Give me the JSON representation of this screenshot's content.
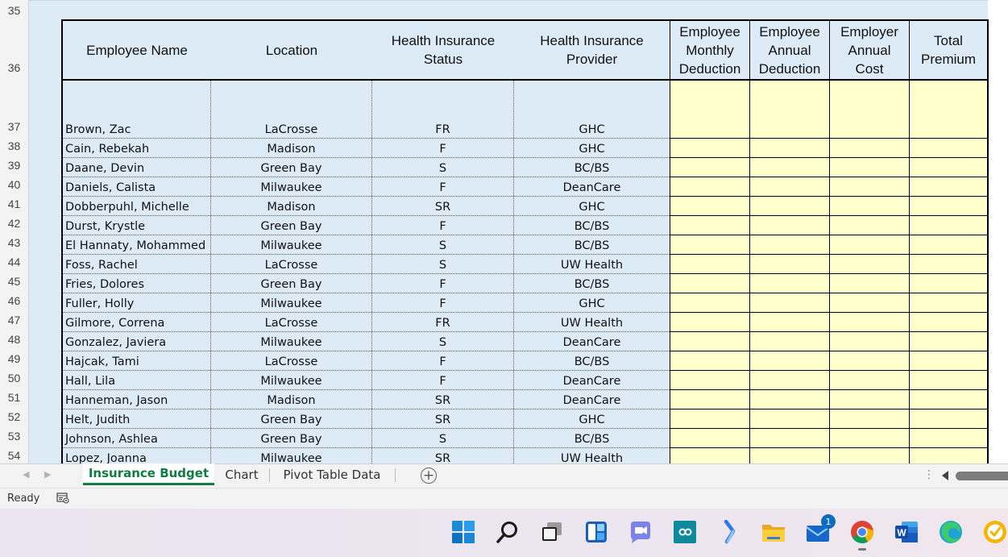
{
  "sheet": {
    "row_numbers": [
      "35",
      "36",
      "37",
      "38",
      "39",
      "40",
      "41",
      "42",
      "43",
      "44",
      "45",
      "46",
      "47",
      "48",
      "49",
      "50",
      "51",
      "52",
      "53",
      "54"
    ],
    "headers": {
      "name": "Employee Name",
      "location": "Location",
      "status": "Health Insurance\nStatus",
      "provider": "Health Insurance\nProvider",
      "monthly": "Employee\nMonthly\nDeduction",
      "annual": "Employee\nAnnual\nDeduction",
      "employer": "Employer\nAnnual\nCost",
      "total": "Total\nPremium"
    },
    "rows": [
      {
        "name": "Brown, Zac",
        "location": "LaCrosse",
        "status": "FR",
        "provider": "GHC"
      },
      {
        "name": "Cain, Rebekah",
        "location": "Madison",
        "status": "F",
        "provider": "GHC"
      },
      {
        "name": "Daane, Devin",
        "location": "Green Bay",
        "status": "S",
        "provider": "BC/BS"
      },
      {
        "name": "Daniels, Calista",
        "location": "Milwaukee",
        "status": "F",
        "provider": "DeanCare"
      },
      {
        "name": "Dobberpuhl, Michelle",
        "location": "Madison",
        "status": "SR",
        "provider": "GHC"
      },
      {
        "name": "Durst, Krystle",
        "location": "Green Bay",
        "status": "F",
        "provider": "BC/BS"
      },
      {
        "name": "El Hannaty, Mohammed",
        "location": "Milwaukee",
        "status": "S",
        "provider": "BC/BS"
      },
      {
        "name": "Foss, Rachel",
        "location": "LaCrosse",
        "status": "S",
        "provider": "UW Health"
      },
      {
        "name": "Fries, Dolores",
        "location": "Green Bay",
        "status": "F",
        "provider": "BC/BS"
      },
      {
        "name": "Fuller, Holly",
        "location": "Milwaukee",
        "status": "F",
        "provider": "GHC"
      },
      {
        "name": "Gilmore, Correna",
        "location": "LaCrosse",
        "status": "FR",
        "provider": "UW Health"
      },
      {
        "name": "Gonzalez, Javiera",
        "location": "Milwaukee",
        "status": "S",
        "provider": "DeanCare"
      },
      {
        "name": "Hajcak, Tami",
        "location": "LaCrosse",
        "status": "F",
        "provider": "BC/BS"
      },
      {
        "name": "Hall, Lila",
        "location": "Milwaukee",
        "status": "F",
        "provider": "DeanCare"
      },
      {
        "name": "Hanneman, Jason",
        "location": "Madison",
        "status": "SR",
        "provider": "DeanCare"
      },
      {
        "name": "Helt, Judith",
        "location": "Green Bay",
        "status": "SR",
        "provider": "GHC"
      },
      {
        "name": "Johnson, Ashlea",
        "location": "Green Bay",
        "status": "S",
        "provider": "BC/BS"
      },
      {
        "name": "Lopez, Joanna",
        "location": "Milwaukee",
        "status": "SR",
        "provider": "UW Health"
      }
    ]
  },
  "tabs": [
    "Insurance Budget",
    "Chart",
    "Pivot Table Data"
  ],
  "active_tab": "Insurance Budget",
  "status": {
    "text": "Ready"
  },
  "taskbar": {
    "icons": [
      "windows-start-icon",
      "search-icon",
      "task-view-icon",
      "widgets-icon",
      "teams-chat-icon",
      "dev-app-icon",
      "visual-studio-icon",
      "file-explorer-icon",
      "mail-icon",
      "chrome-icon",
      "word-icon",
      "edge-icon",
      "norton-icon"
    ],
    "mail_badge": "1"
  },
  "colors": {
    "header_bg": "#ddebf7",
    "input_bg": "#ffffcc",
    "active_tab": "#107c41"
  }
}
